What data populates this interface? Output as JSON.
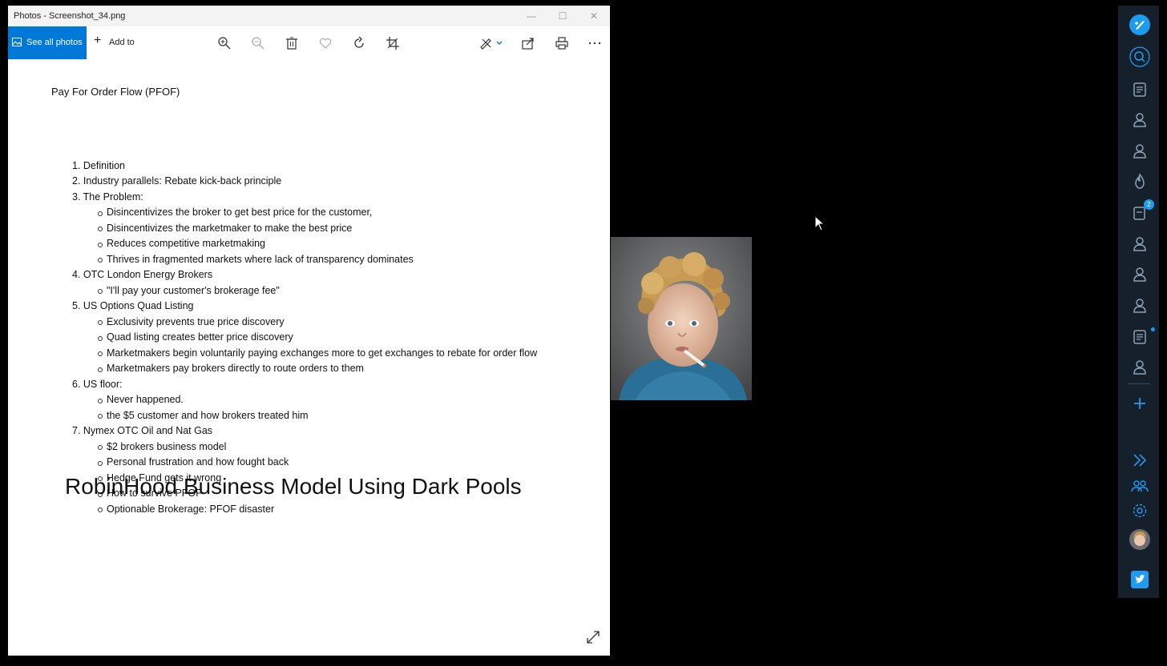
{
  "window": {
    "title": "Photos - Screenshot_34.png",
    "controls": {
      "minimize": "—",
      "maximize": "☐",
      "close": "✕"
    }
  },
  "toolbar": {
    "see_all_label": "See all photos",
    "add_to_label": "Add to",
    "plus_glyph": "+"
  },
  "document": {
    "title": "Pay For Order Flow (PFOF)",
    "items": [
      {
        "label": "1. Definition"
      },
      {
        "label": "2. Industry parallels: Rebate kick-back principle"
      },
      {
        "label": "3. The Problem:"
      },
      {
        "label": "Disincentivizes the broker to get best price for the customer,"
      },
      {
        "label": "Disincentivizes the marketmaker to make the best price"
      },
      {
        "label": "Reduces competitive marketmaking"
      },
      {
        "label": "Thrives in fragmented markets where lack of transparency dominates"
      },
      {
        "label": "4. OTC London Energy Brokers"
      },
      {
        "label": "\"I'll pay your customer's brokerage fee\""
      },
      {
        "label": "5. US Options Quad Listing"
      },
      {
        "label": "Exclusivity prevents true price discovery"
      },
      {
        "label": "Quad listing creates better price discovery"
      },
      {
        "label": "Marketmakers begin voluntarily paying exchanges more to get exchanges to rebate for order flow"
      },
      {
        "label": "Marketmakers pay brokers directly to route orders to them"
      },
      {
        "label": "6. US floor:"
      },
      {
        "label": "Never happened."
      },
      {
        "label": "the $5 customer and how brokers treated him"
      },
      {
        "label": "7. Nymex OTC Oil and Nat Gas"
      },
      {
        "label": "$2 brokers business model"
      },
      {
        "label": "Personal frustration and how fought back"
      },
      {
        "label": "Hedge Fund gets it wrong"
      },
      {
        "label": "How to survive PFOF"
      },
      {
        "label": "Optionable Brokerage: PFOF disaster"
      }
    ],
    "heading": "RobinHood Business Model Using Dark Pools"
  },
  "sidebar": {
    "notification_count": "2",
    "accent_color": "#1d9bf0"
  }
}
